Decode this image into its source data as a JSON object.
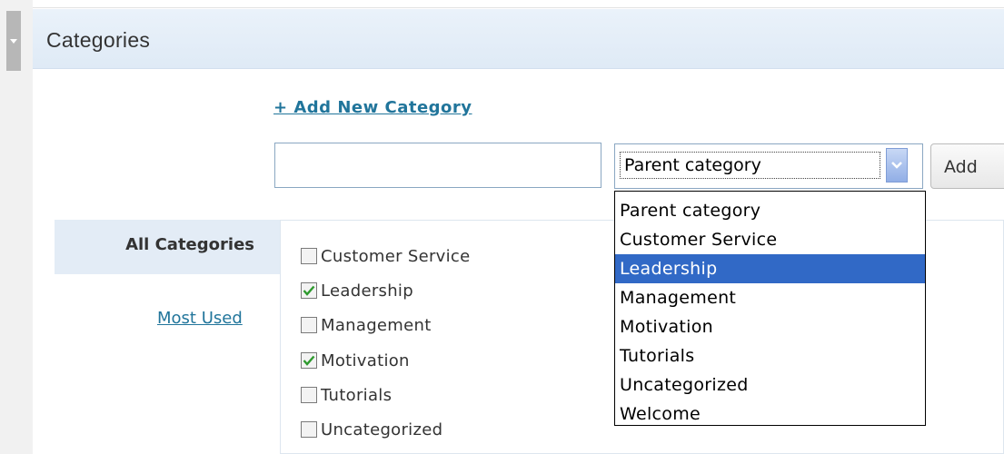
{
  "panel": {
    "title": "Categories"
  },
  "add_new": {
    "link_label": "+ Add New Category",
    "name_value": "",
    "parent_select_value": "Parent category",
    "add_button_label": "Add"
  },
  "tabs": {
    "all_label": "All Categories",
    "most_used_label": "Most Used"
  },
  "categories": [
    {
      "label": "Customer Service",
      "checked": false
    },
    {
      "label": "Leadership",
      "checked": true
    },
    {
      "label": "Management",
      "checked": false
    },
    {
      "label": "Motivation",
      "checked": true
    },
    {
      "label": "Tutorials",
      "checked": false
    },
    {
      "label": "Uncategorized",
      "checked": false
    }
  ],
  "dropdown": {
    "options": [
      "Parent category",
      "Customer Service",
      "Leadership",
      "Management",
      "Motivation",
      "Tutorials",
      "Uncategorized",
      "Welcome"
    ],
    "highlighted": "Leadership"
  },
  "colors": {
    "link": "#21759b",
    "header_bg": "#dfeaf6",
    "highlight": "#3169c6",
    "check": "#2e9a2e"
  }
}
